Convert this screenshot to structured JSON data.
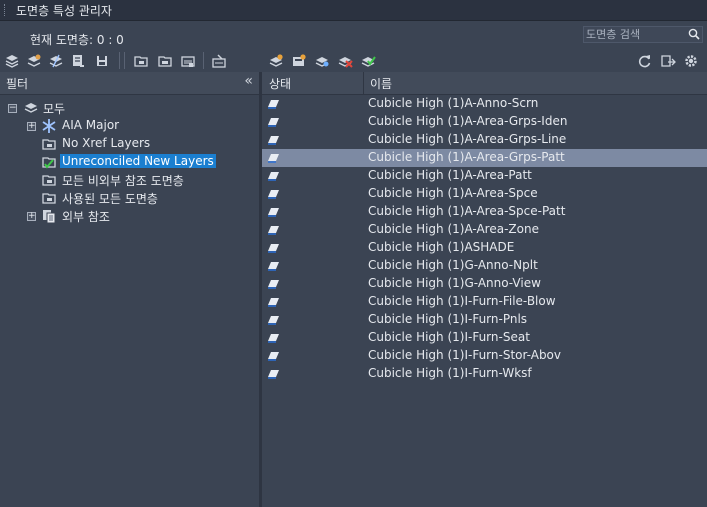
{
  "window": {
    "title": "도면층 특성 관리자"
  },
  "current_layer": "현재 도면층: 0 : 0",
  "search": {
    "placeholder": "도면층 검색",
    "value": ""
  },
  "toolbar_left_icons": [
    "new-property-filter-icon",
    "new-group-filter-icon",
    "layer-states-icon",
    "new-layer-icon",
    "save-icon",
    "new-layer-vp-frozen-icon",
    "delete-layer-icon",
    "set-current-icon",
    "merge-icon"
  ],
  "toolbar_right_icons": [
    "new-layer-2-icon",
    "new-layer-vp-frozen-2-icon",
    "layer-settings-icon",
    "delete-layer-2-icon",
    "set-current-2-icon"
  ],
  "toolbar_far_right_icons": [
    "refresh-icon",
    "export-icon",
    "settings-gear-icon"
  ],
  "filter_panel": {
    "header": "필터",
    "collapse_glyph": "«",
    "tree": [
      {
        "label": "모두"
      },
      {
        "label": "AIA Major"
      },
      {
        "label": "No Xref Layers"
      },
      {
        "label": "Unreconciled New Layers"
      },
      {
        "label": "모든 비외부 참조 도면층"
      },
      {
        "label": "사용된 모든 도면층"
      },
      {
        "label": "외부 참조"
      }
    ]
  },
  "layer_list": {
    "columns": [
      "상태",
      "이름"
    ],
    "selected_index": 3,
    "rows": [
      "Cubicle High (1)A-Anno-Scrn",
      "Cubicle High (1)A-Area-Grps-Iden",
      "Cubicle High (1)A-Area-Grps-Line",
      "Cubicle High (1)A-Area-Grps-Patt",
      "Cubicle High (1)A-Area-Patt",
      "Cubicle High (1)A-Area-Spce",
      "Cubicle High (1)A-Area-Spce-Patt",
      "Cubicle High (1)A-Area-Zone",
      "Cubicle High (1)ASHADE",
      "Cubicle High (1)G-Anno-Nplt",
      "Cubicle High (1)G-Anno-View",
      "Cubicle High (1)I-Furn-File-Blow",
      "Cubicle High (1)I-Furn-Pnls",
      "Cubicle High (1)I-Furn-Seat",
      "Cubicle High (1)I-Furn-Stor-Abov",
      "Cubicle High (1)I-Furn-Wksf"
    ]
  },
  "colors": {
    "background": "#3b4453",
    "selection_row": "#7d8aa3",
    "selection_tree": "#1b7fd0"
  }
}
